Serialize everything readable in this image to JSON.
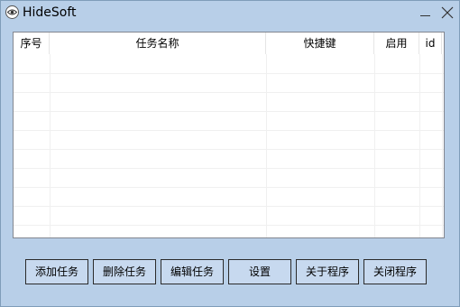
{
  "window": {
    "title": "HideSoft"
  },
  "icons": {
    "app": "eye-icon",
    "minimize": "minimize-icon",
    "close": "close-icon"
  },
  "table": {
    "columns": [
      "序号",
      "任务名称",
      "快捷键",
      "启用",
      "id"
    ],
    "rows": []
  },
  "buttons": {
    "add": "添加任务",
    "delete": "删除任务",
    "edit": "编辑任务",
    "settings": "设置",
    "about": "关于程序",
    "close_program": "关闭程序"
  },
  "colors": {
    "window_bg": "#b8cfe8",
    "button_bg": "#c7d9ef",
    "grid_bg": "#ffffff"
  }
}
